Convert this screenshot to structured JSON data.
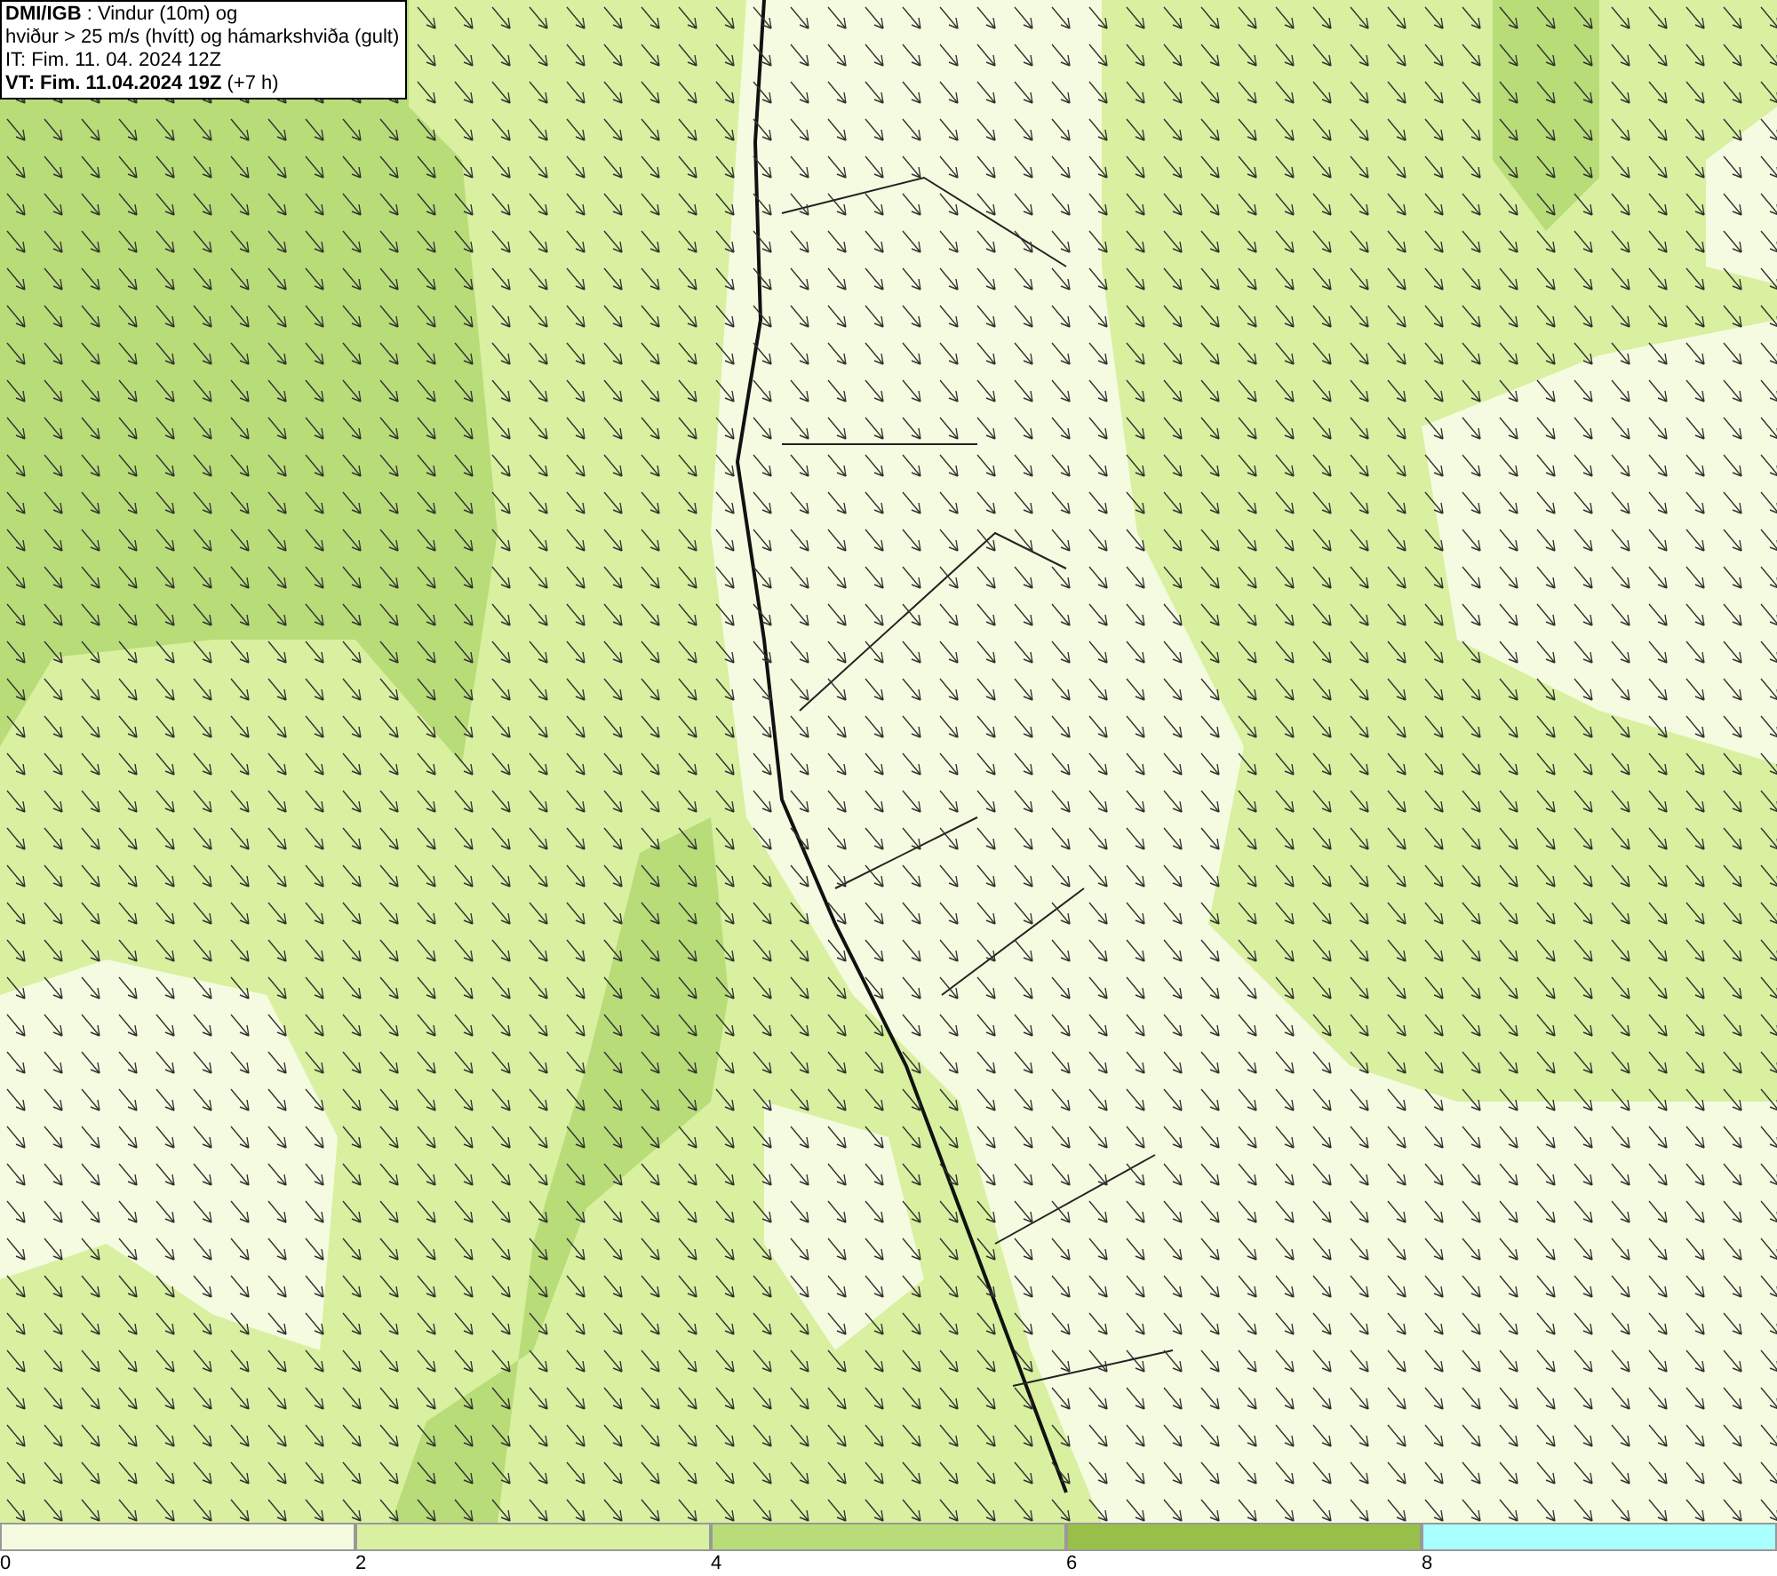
{
  "legend": {
    "lines": [
      "**DMI/IGB** : Vindur (10m) og",
      "hviður > 25 m/s (hvítt) og hámarkshviða (gult)",
      "IT: Fim. 11. 04. 2024 12Z",
      "**VT: Fim. 11.04.2024 19Z** (+7 h)"
    ]
  },
  "scale": [
    {
      "label": "0",
      "color": "#f5fbe0"
    },
    {
      "label": "2",
      "color": "#d8f0a0"
    },
    {
      "label": "4",
      "color": "#b8dc78"
    },
    {
      "label": "6",
      "color": "#98c048"
    },
    {
      "label": "8",
      "color": "#aaffff"
    }
  ]
}
